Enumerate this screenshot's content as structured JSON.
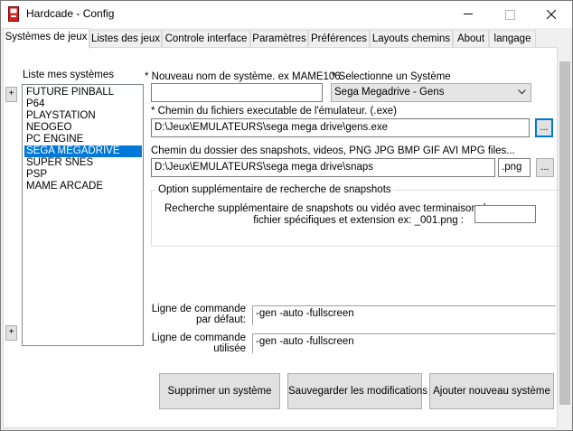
{
  "window": {
    "title": "Hardcade - Config",
    "icon": "arcade-cabinet-icon",
    "controls": [
      "minimize-icon",
      "maximize-icon",
      "close-icon"
    ]
  },
  "tabs": [
    {
      "label": "Systèmes de jeux",
      "active": true
    },
    {
      "label": "Listes des jeux"
    },
    {
      "label": "Controle interface"
    },
    {
      "label": "Paramètres"
    },
    {
      "label": "Préférences"
    },
    {
      "label": "Layouts chemins"
    },
    {
      "label": "About"
    },
    {
      "label": "langage"
    }
  ],
  "systems": {
    "label": "Liste mes systèmes",
    "add_top": "+",
    "add_bottom": "+",
    "items": [
      "FUTURE PINBALL",
      "P64",
      "PLAYSTATION",
      "NEOGEO",
      "PC ENGINE",
      "SEGA MEGADRIVE",
      "SUPER SNES",
      "PSP",
      "MAME ARCADE"
    ],
    "selected": "SEGA MEGADRIVE"
  },
  "form": {
    "new_name_label": "* Nouveau nom de système. ex MAME106",
    "new_name_value": "",
    "select_system_label": "* Selectionne  un Système",
    "select_system_value": "Sega Megadrive - Gens",
    "exe_path_label": "* Chemin du fichiers executable de l'émulateur. (.exe)",
    "exe_path_value": "D:\\Jeux\\EMULATEURS\\sega mega drive\\gens.exe",
    "browse_label": "...",
    "snap_path_label": "Chemin du dossier des snapshots, videos, PNG JPG BMP GIF AVI MPG files...",
    "snap_path_value": "D:\\Jeux\\EMULATEURS\\sega mega drive\\snaps",
    "snap_ext_value": ".png",
    "snap_option_group": "Option supplémentaire de recherche de snapshots",
    "snap_option_desc_1": "Recherche supplémentaire de snapshots ou vidéo avec terminaison de",
    "snap_option_desc_2": "fichier spécifiques et extension ex: _001.png :",
    "snap_suffix_value": "",
    "cmd_default_label_1": "Ligne de commande",
    "cmd_default_label_2": "par défaut:",
    "cmd_default_value": "-gen -auto -fullscreen",
    "cmd_used_label_1": "Ligne de commande",
    "cmd_used_label_2": "utilisée",
    "cmd_used_value": "-gen -auto -fullscreen"
  },
  "actions": {
    "delete": "Supprimer un système",
    "save": "Sauvegarder les modifications",
    "add": "Ajouter nouveau système"
  }
}
